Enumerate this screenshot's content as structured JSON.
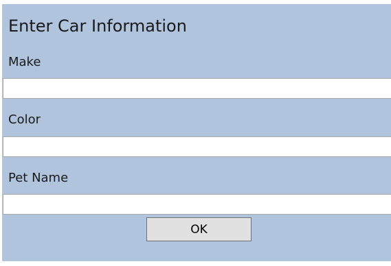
{
  "form": {
    "title": "Enter Car Information",
    "fields": [
      {
        "label": "Make",
        "value": ""
      },
      {
        "label": "Color",
        "value": ""
      },
      {
        "label": "Pet Name",
        "value": ""
      }
    ],
    "ok_label": "OK"
  },
  "colors": {
    "background": "#b0c4de",
    "input_background": "#ffffff",
    "button_background": "#e1e1e1"
  }
}
